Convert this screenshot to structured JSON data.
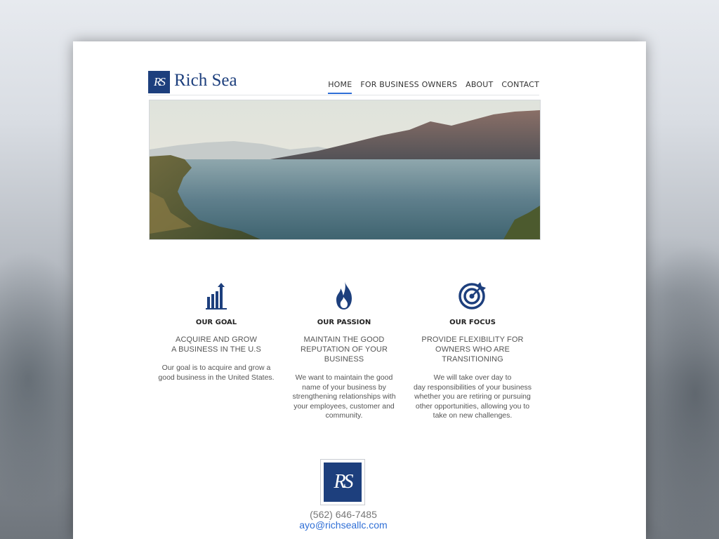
{
  "brand": {
    "name": "Rich Sea",
    "mark": "RS",
    "color": "#1d3f7d"
  },
  "nav": {
    "items": [
      {
        "label": "HOME",
        "active": true
      },
      {
        "label": "FOR BUSINESS OWNERS",
        "active": false
      },
      {
        "label": "ABOUT",
        "active": false
      },
      {
        "label": "CONTACT",
        "active": false
      }
    ],
    "active_color": "#2f6fd6"
  },
  "hero": {
    "scene": "lake-mountain-landscape"
  },
  "features": [
    {
      "icon": "bar-chart-growth-icon",
      "heading": "OUR GOAL",
      "subheading_lines": [
        "ACQUIRE AND GROW",
        "A BUSINESS IN THE U.S"
      ],
      "body_lines": [
        "Our goal is to acquire and grow a",
        "good business in the United States."
      ]
    },
    {
      "icon": "flame-icon",
      "heading": "OUR PASSION",
      "subheading_lines": [
        "MAINTAIN THE GOOD",
        "REPUTATION OF YOUR BUSINESS"
      ],
      "body_lines": [
        "We want to maintain the good",
        "name of your business  by",
        "strengthening relationships with",
        "your employees, customer and",
        "community."
      ]
    },
    {
      "icon": "target-icon",
      "heading": "OUR FOCUS",
      "subheading_lines": [
        "PROVIDE FLEXIBILITY FOR",
        "OWNERS WHO ARE",
        "TRANSITIONING"
      ],
      "body_lines": [
        "We will take over day to",
        "day responsibilities of your business",
        "whether you are retiring or pursuing",
        "other opportunities, allowing you to",
        "take on new challenges."
      ]
    }
  ],
  "footer": {
    "logo_mark": "RS",
    "phone": "(562) 646-7485",
    "email": "ayo@richseallc.com"
  }
}
